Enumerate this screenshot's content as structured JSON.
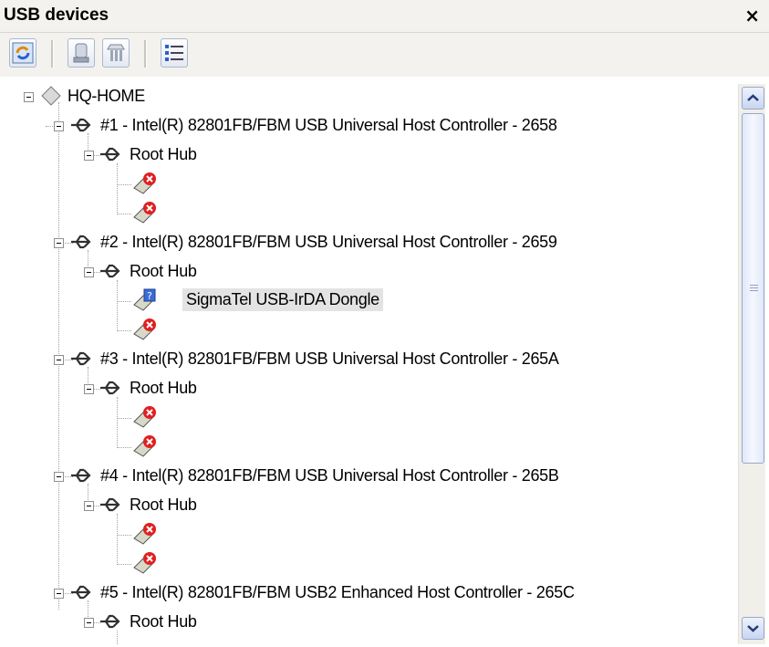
{
  "panel": {
    "title": "USB devices",
    "close_symbol": "×"
  },
  "toolbar": {
    "buttons": [
      "refresh-icon",
      "device-icon",
      "hub-icon",
      "list-view-icon"
    ]
  },
  "tree": {
    "root": "HQ-HOME",
    "controllers": [
      {
        "label": "#1 - Intel(R) 82801FB/FBM USB Universal Host Controller - 2658",
        "hub": "Root Hub"
      },
      {
        "label": "#2 - Intel(R) 82801FB/FBM USB Universal Host Controller - 2659",
        "hub": "Root Hub",
        "device": "SigmaTel USB-IrDA Dongle"
      },
      {
        "label": "#3 - Intel(R) 82801FB/FBM USB Universal Host Controller - 265A",
        "hub": "Root Hub"
      },
      {
        "label": "#4 - Intel(R) 82801FB/FBM USB Universal Host Controller - 265B",
        "hub": "Root Hub"
      },
      {
        "label": "#5 - Intel(R) 82801FB/FBM USB2 Enhanced Host Controller - 265C",
        "hub": "Root Hub"
      }
    ]
  },
  "colors": {
    "accent": "#2a5fd0",
    "error": "#e02020",
    "unknown": "#3a6cd8"
  }
}
